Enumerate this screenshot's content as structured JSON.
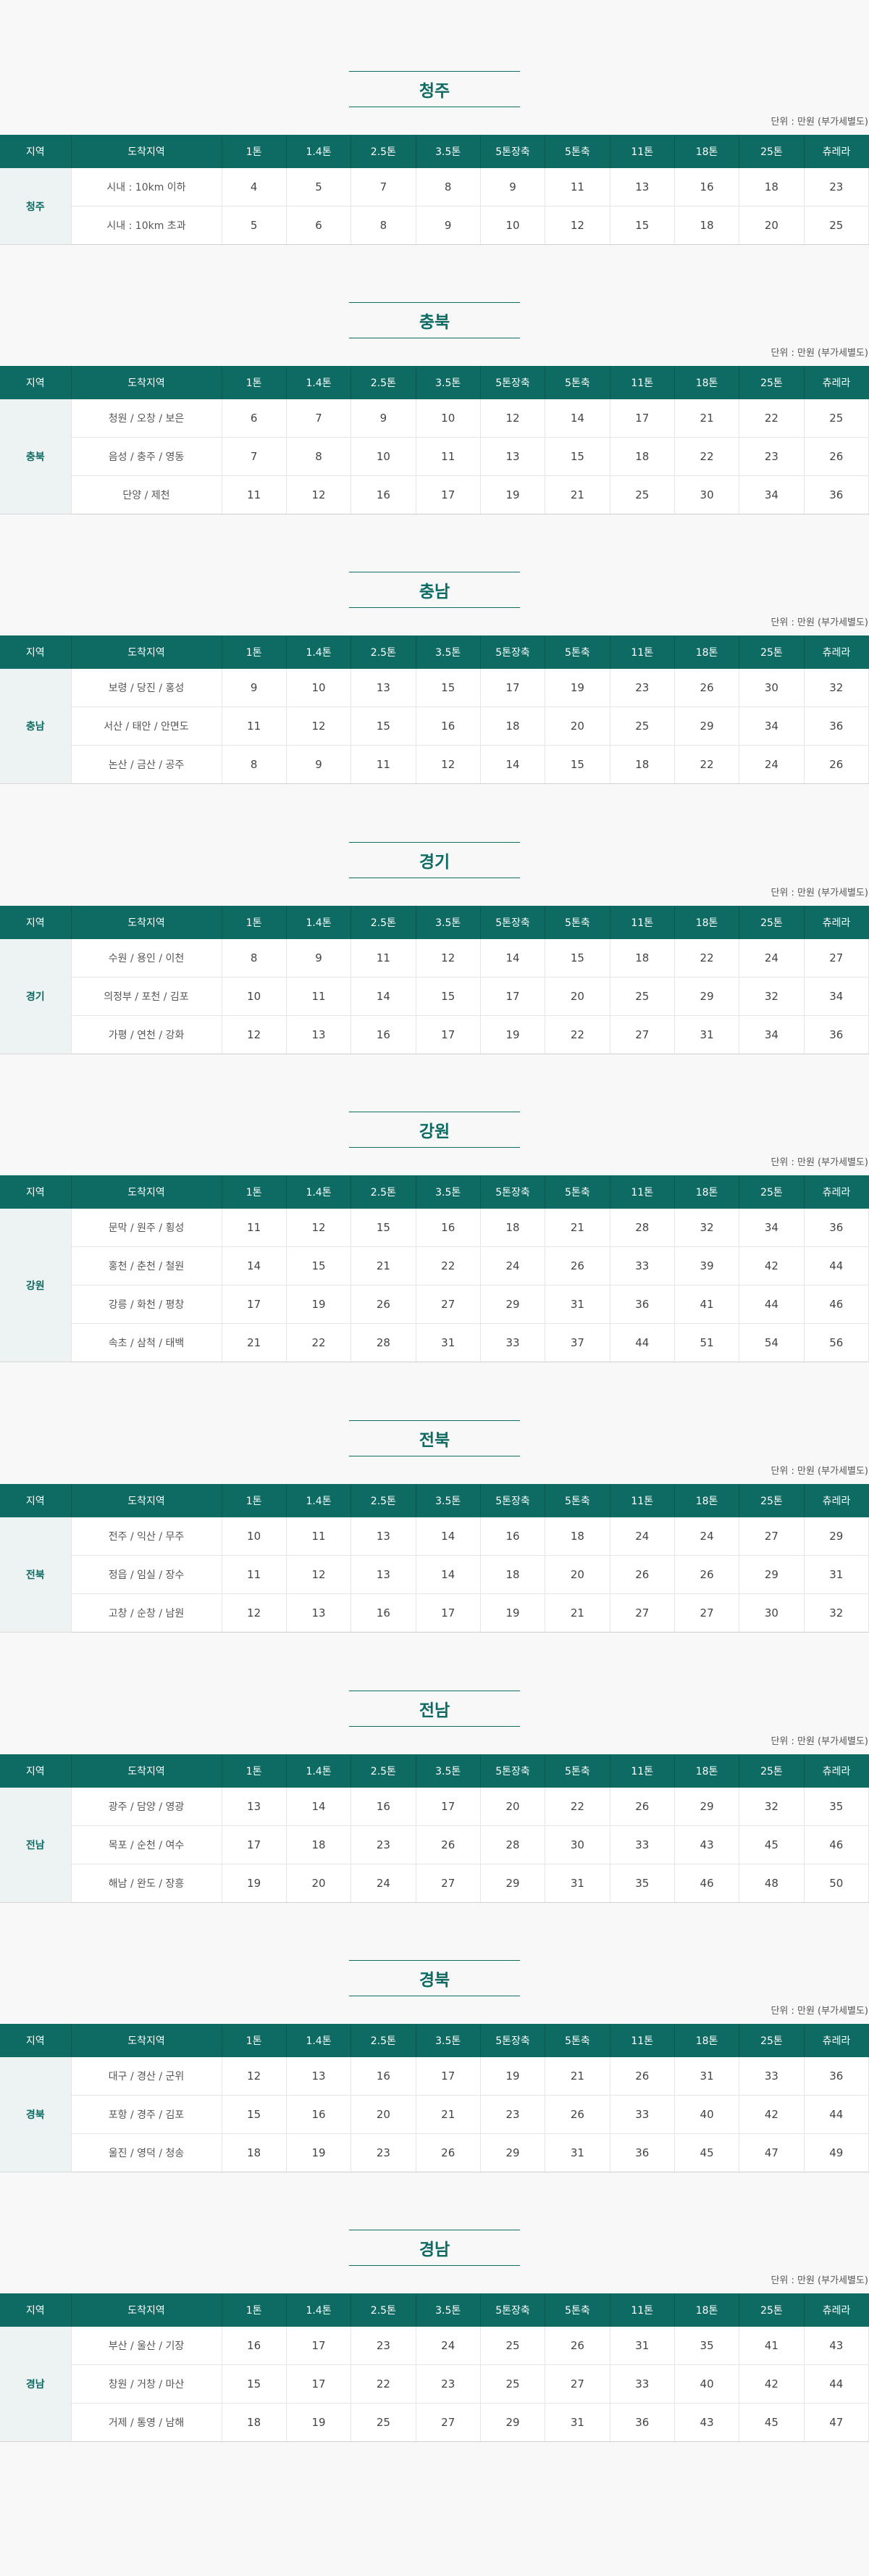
{
  "unit_note": "단위 : 만원 (부가세별도)",
  "columns": [
    "지역",
    "도착지역",
    "1톤",
    "1.4톤",
    "2.5톤",
    "3.5톤",
    "5톤장축",
    "5톤축",
    "11톤",
    "18톤",
    "25톤",
    "츄레라"
  ],
  "sections": [
    {
      "title": "청주",
      "region": "청주",
      "rows": [
        {
          "dest": "시내 : 10km 이하",
          "prices": [
            "4",
            "5",
            "7",
            "8",
            "9",
            "11",
            "13",
            "16",
            "18",
            "23"
          ]
        },
        {
          "dest": "시내 : 10km 초과",
          "prices": [
            "5",
            "6",
            "8",
            "9",
            "10",
            "12",
            "15",
            "18",
            "20",
            "25"
          ]
        }
      ]
    },
    {
      "title": "충북",
      "region": "충북",
      "rows": [
        {
          "dest": "청원 / 오창 / 보은",
          "prices": [
            "6",
            "7",
            "9",
            "10",
            "12",
            "14",
            "17",
            "21",
            "22",
            "25"
          ]
        },
        {
          "dest": "음성 / 충주 / 영동",
          "prices": [
            "7",
            "8",
            "10",
            "11",
            "13",
            "15",
            "18",
            "22",
            "23",
            "26"
          ]
        },
        {
          "dest": "단양 / 제천",
          "prices": [
            "11",
            "12",
            "16",
            "17",
            "19",
            "21",
            "25",
            "30",
            "34",
            "36"
          ]
        }
      ]
    },
    {
      "title": "충남",
      "region": "충남",
      "rows": [
        {
          "dest": "보령 / 당진 / 홍성",
          "prices": [
            "9",
            "10",
            "13",
            "15",
            "17",
            "19",
            "23",
            "26",
            "30",
            "32"
          ]
        },
        {
          "dest": "서산 / 태안 / 안면도",
          "prices": [
            "11",
            "12",
            "15",
            "16",
            "18",
            "20",
            "25",
            "29",
            "34",
            "36"
          ]
        },
        {
          "dest": "논산 / 금산 / 공주",
          "prices": [
            "8",
            "9",
            "11",
            "12",
            "14",
            "15",
            "18",
            "22",
            "24",
            "26"
          ]
        }
      ]
    },
    {
      "title": "경기",
      "region": "경기",
      "rows": [
        {
          "dest": "수원 / 용인 / 이천",
          "prices": [
            "8",
            "9",
            "11",
            "12",
            "14",
            "15",
            "18",
            "22",
            "24",
            "27"
          ]
        },
        {
          "dest": "의정부 / 포천 / 김포",
          "prices": [
            "10",
            "11",
            "14",
            "15",
            "17",
            "20",
            "25",
            "29",
            "32",
            "34"
          ]
        },
        {
          "dest": "가평 / 연천 / 강화",
          "prices": [
            "12",
            "13",
            "16",
            "17",
            "19",
            "22",
            "27",
            "31",
            "34",
            "36"
          ]
        }
      ]
    },
    {
      "title": "강원",
      "region": "강원",
      "rows": [
        {
          "dest": "문막 / 원주 / 횡성",
          "prices": [
            "11",
            "12",
            "15",
            "16",
            "18",
            "21",
            "28",
            "32",
            "34",
            "36"
          ]
        },
        {
          "dest": "홍천 / 춘천 / 철원",
          "prices": [
            "14",
            "15",
            "21",
            "22",
            "24",
            "26",
            "33",
            "39",
            "42",
            "44"
          ]
        },
        {
          "dest": "강릉 / 화천 / 평창",
          "prices": [
            "17",
            "19",
            "26",
            "27",
            "29",
            "31",
            "36",
            "41",
            "44",
            "46"
          ]
        },
        {
          "dest": "속초 / 삼척 / 태백",
          "prices": [
            "21",
            "22",
            "28",
            "31",
            "33",
            "37",
            "44",
            "51",
            "54",
            "56"
          ]
        }
      ]
    },
    {
      "title": "전북",
      "region": "전북",
      "rows": [
        {
          "dest": "전주 / 익산 / 무주",
          "prices": [
            "10",
            "11",
            "13",
            "14",
            "16",
            "18",
            "24",
            "24",
            "27",
            "29"
          ]
        },
        {
          "dest": "정읍 / 임실 / 장수",
          "prices": [
            "11",
            "12",
            "13",
            "14",
            "18",
            "20",
            "26",
            "26",
            "29",
            "31"
          ]
        },
        {
          "dest": "고창 / 순창 / 남원",
          "prices": [
            "12",
            "13",
            "16",
            "17",
            "19",
            "21",
            "27",
            "27",
            "30",
            "32"
          ]
        }
      ]
    },
    {
      "title": "전남",
      "region": "전남",
      "rows": [
        {
          "dest": "광주 / 담양 / 영광",
          "prices": [
            "13",
            "14",
            "16",
            "17",
            "20",
            "22",
            "26",
            "29",
            "32",
            "35"
          ]
        },
        {
          "dest": "목포 / 순천 / 여수",
          "prices": [
            "17",
            "18",
            "23",
            "26",
            "28",
            "30",
            "33",
            "43",
            "45",
            "46"
          ]
        },
        {
          "dest": "해남 / 완도 / 장흥",
          "prices": [
            "19",
            "20",
            "24",
            "27",
            "29",
            "31",
            "35",
            "46",
            "48",
            "50"
          ]
        }
      ]
    },
    {
      "title": "경북",
      "region": "경북",
      "rows": [
        {
          "dest": "대구 / 경산 / 군위",
          "prices": [
            "12",
            "13",
            "16",
            "17",
            "19",
            "21",
            "26",
            "31",
            "33",
            "36"
          ]
        },
        {
          "dest": "포항 / 경주 / 김포",
          "prices": [
            "15",
            "16",
            "20",
            "21",
            "23",
            "26",
            "33",
            "40",
            "42",
            "44"
          ]
        },
        {
          "dest": "울진 / 영덕 / 청송",
          "prices": [
            "18",
            "19",
            "23",
            "26",
            "29",
            "31",
            "36",
            "45",
            "47",
            "49"
          ]
        }
      ]
    },
    {
      "title": "경남",
      "region": "경남",
      "rows": [
        {
          "dest": "부산 / 울산 / 기장",
          "prices": [
            "16",
            "17",
            "23",
            "24",
            "25",
            "26",
            "31",
            "35",
            "41",
            "43"
          ]
        },
        {
          "dest": "창원 / 거창 / 마산",
          "prices": [
            "15",
            "17",
            "22",
            "23",
            "25",
            "27",
            "33",
            "40",
            "42",
            "44"
          ]
        },
        {
          "dest": "거제 / 통영 / 남해",
          "prices": [
            "18",
            "19",
            "25",
            "27",
            "29",
            "31",
            "36",
            "43",
            "45",
            "47"
          ]
        }
      ]
    }
  ]
}
